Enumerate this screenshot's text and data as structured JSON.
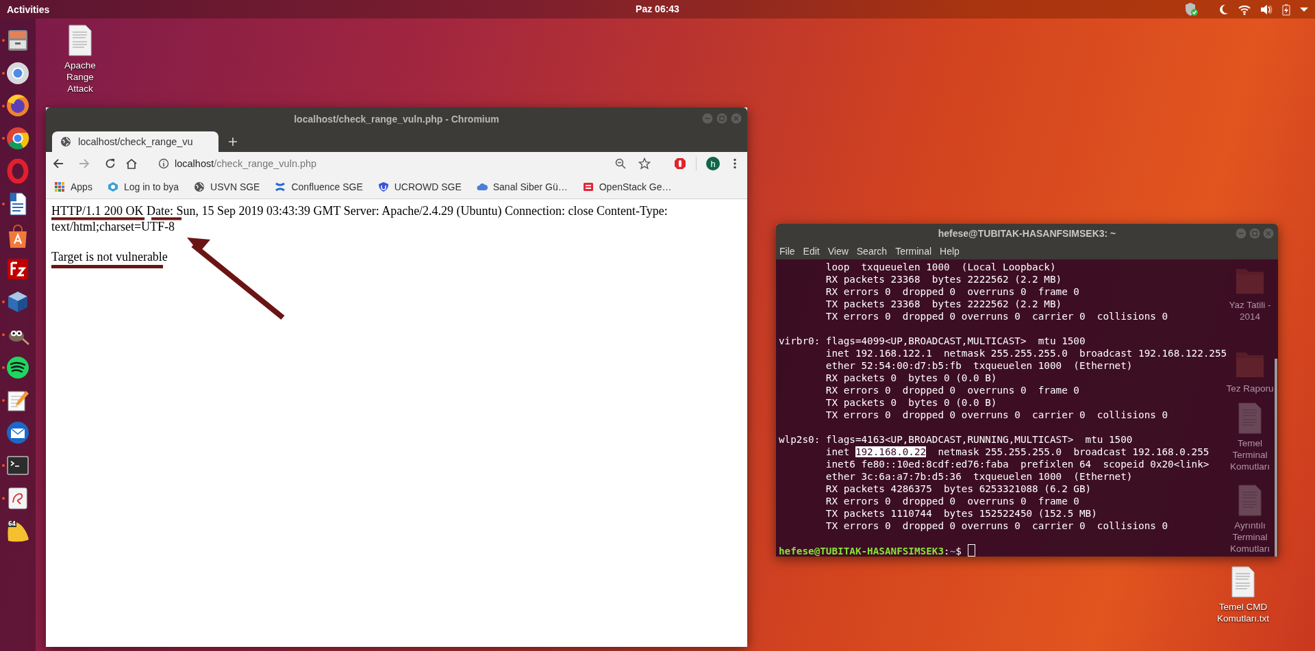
{
  "top_bar": {
    "activities": "Activities",
    "clock": "Paz 06:43"
  },
  "dock": {
    "apps": [
      {
        "kind": "files",
        "running": true
      },
      {
        "kind": "chromium",
        "running": true
      },
      {
        "kind": "firefox",
        "running": true
      },
      {
        "kind": "chrome",
        "running": true
      },
      {
        "kind": "opera",
        "running": false
      },
      {
        "kind": "writer",
        "running": true
      },
      {
        "kind": "software",
        "running": false
      },
      {
        "kind": "filezilla",
        "running": false
      },
      {
        "kind": "virtualbox",
        "running": true
      },
      {
        "kind": "gimp",
        "running": true
      },
      {
        "kind": "spotify",
        "running": true
      },
      {
        "kind": "editor",
        "running": true
      },
      {
        "kind": "mail",
        "running": false
      },
      {
        "kind": "terminal",
        "running": true
      },
      {
        "kind": "viewer",
        "running": true
      },
      {
        "kind": "tile",
        "running": false,
        "label": "64"
      }
    ]
  },
  "desktop_icons": [
    {
      "kind": "document",
      "label": "Apache Range Attack",
      "faded": false
    },
    {
      "kind": "folder",
      "label": "Yaz Tatili - 2014",
      "faded": true
    },
    {
      "kind": "folder",
      "label": "Tez Raporu",
      "faded": true
    },
    {
      "kind": "document",
      "label": "Temel Terminal Komutları",
      "faded": true
    },
    {
      "kind": "document",
      "label": "Ayrıntılı Terminal Komutları",
      "faded": true
    },
    {
      "kind": "document",
      "label": "Temel CMD Komutları.txt",
      "faded": false
    }
  ],
  "browser": {
    "title": "localhost/check_range_vuln.php - Chromium",
    "tabs": [
      {
        "title": "localhost/check_range_vu",
        "selected": true
      }
    ],
    "address": {
      "host": "localhost",
      "path": "/check_range_vuln.php"
    },
    "profile": "h",
    "bookmarks": [
      {
        "kind": "apps",
        "label": "Apps"
      },
      {
        "kind": "hexagon",
        "label": "Log in to bya"
      },
      {
        "kind": "globe",
        "label": "USVN SGE"
      },
      {
        "kind": "cross",
        "label": "Confluence SGE"
      },
      {
        "kind": "shield",
        "label": "UCROWD SGE"
      },
      {
        "kind": "cloud",
        "label": "Sanal Siber Gü…"
      },
      {
        "kind": "square",
        "label": "OpenStack Ge…"
      }
    ],
    "content": {
      "response_lines": [
        "HTTP/1.1 200 OK Date: Sun, 15 Sep 2019 03:43:39 GMT Server: Apache/2.4.29 (Ubuntu) Connection: close Content-Type:",
        "text/html;charset=UTF-8"
      ],
      "result": "Target is not vulnerable"
    }
  },
  "terminal": {
    "title": "hefese@TUBITAK-HASANFSIMSEK3: ~",
    "menu": [
      "File",
      "Edit",
      "View",
      "Search",
      "Terminal",
      "Help"
    ],
    "lines": [
      {
        "kind": "plain",
        "text": "        loop  txqueuelen 1000  (Local Loopback)"
      },
      {
        "kind": "plain",
        "text": "        RX packets 23368  bytes 2222562 (2.2 MB)"
      },
      {
        "kind": "plain",
        "text": "        RX errors 0  dropped 0  overruns 0  frame 0"
      },
      {
        "kind": "plain",
        "text": "        TX packets 23368  bytes 2222562 (2.2 MB)"
      },
      {
        "kind": "plain",
        "text": "        TX errors 0  dropped 0 overruns 0  carrier 0  collisions 0"
      },
      {
        "kind": "blank"
      },
      {
        "kind": "plain",
        "text": "virbr0: flags=4099<UP,BROADCAST,MULTICAST>  mtu 1500"
      },
      {
        "kind": "plain",
        "text": "        inet 192.168.122.1  netmask 255.255.255.0  broadcast 192.168.122.255"
      },
      {
        "kind": "plain",
        "text": "        ether 52:54:00:d7:b5:fb  txqueuelen 1000  (Ethernet)"
      },
      {
        "kind": "plain",
        "text": "        RX packets 0  bytes 0 (0.0 B)"
      },
      {
        "kind": "plain",
        "text": "        RX errors 0  dropped 0  overruns 0  frame 0"
      },
      {
        "kind": "plain",
        "text": "        TX packets 0  bytes 0 (0.0 B)"
      },
      {
        "kind": "plain",
        "text": "        TX errors 0  dropped 0 overruns 0  carrier 0  collisions 0"
      },
      {
        "kind": "blank"
      },
      {
        "kind": "plain",
        "text": "wlp2s0: flags=4163<UP,BROADCAST,RUNNING,MULTICAST>  mtu 1500"
      },
      {
        "kind": "parts",
        "parts": [
          {
            "text": "        inet ",
            "highlighted": false
          },
          {
            "text": "192.168.0.22",
            "highlighted": true
          },
          {
            "text": "  netmask 255.255.255.0  broadcast 192.168.0.255",
            "highlighted": false
          }
        ]
      },
      {
        "kind": "plain",
        "text": "        inet6 fe80::10ed:8cdf:ed76:faba  prefixlen 64  scopeid 0x20<link>"
      },
      {
        "kind": "plain",
        "text": "        ether 3c:6a:a7:7b:d5:36  txqueuelen 1000  (Ethernet)"
      },
      {
        "kind": "plain",
        "text": "        RX packets 4286375  bytes 6253321088 (6.2 GB)"
      },
      {
        "kind": "plain",
        "text": "        RX errors 0  dropped 0  overruns 0  frame 0"
      },
      {
        "kind": "plain",
        "text": "        TX packets 1110744  bytes 152522450 (152.5 MB)"
      },
      {
        "kind": "plain",
        "text": "        TX errors 0  dropped 0 overruns 0  carrier 0  collisions 0"
      },
      {
        "kind": "blank"
      }
    ],
    "prompt": {
      "user_host": "hefese@TUBITAK-HASANFSIMSEK3",
      "separator": ":",
      "path": "~",
      "symbol": "$"
    }
  }
}
